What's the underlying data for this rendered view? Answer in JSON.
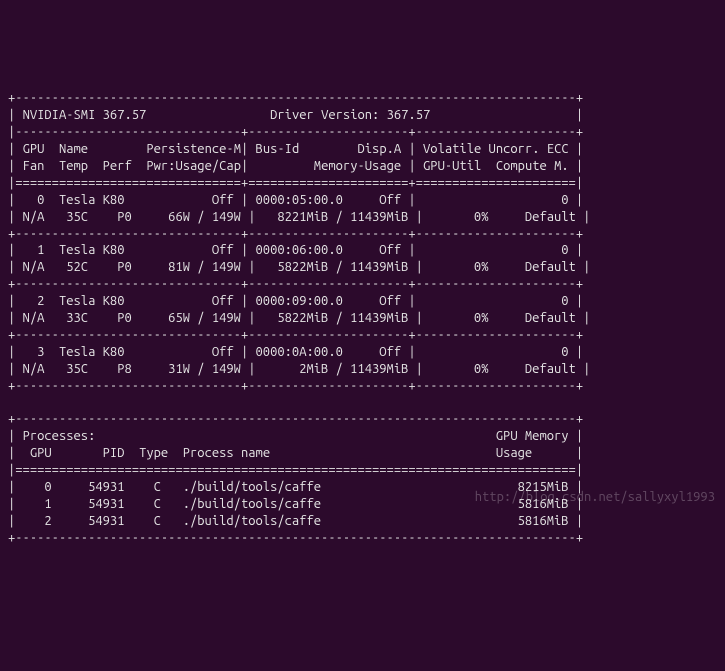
{
  "header": {
    "smi_label": "NVIDIA-SMI",
    "smi_version": "367.57",
    "driver_label": "Driver Version:",
    "driver_version": "367.57"
  },
  "col_headers": {
    "gpu": "GPU",
    "name": "Name",
    "persistence": "Persistence-M",
    "bus": "Bus-Id",
    "disp": "Disp.A",
    "volatile": "Volatile",
    "uncorr": "Uncorr. ECC",
    "fan": "Fan",
    "temp": "Temp",
    "perf": "Perf",
    "pwr": "Pwr:Usage/Cap",
    "memusage": "Memory-Usage",
    "gpuutil": "GPU-Util",
    "compute": "Compute M."
  },
  "gpus": [
    {
      "id": "0",
      "name": "Tesla K80",
      "persist": "Off",
      "bus": "0000:05:00.0",
      "disp": "Off",
      "ecc": "0",
      "fan": "N/A",
      "temp": "35C",
      "perf": "P0",
      "pwr_use": "66W",
      "pwr_cap": "149W",
      "mem_use": "8221MiB",
      "mem_tot": "11439MiB",
      "util": "0%",
      "compute": "Default"
    },
    {
      "id": "1",
      "name": "Tesla K80",
      "persist": "Off",
      "bus": "0000:06:00.0",
      "disp": "Off",
      "ecc": "0",
      "fan": "N/A",
      "temp": "52C",
      "perf": "P0",
      "pwr_use": "81W",
      "pwr_cap": "149W",
      "mem_use": "5822MiB",
      "mem_tot": "11439MiB",
      "util": "0%",
      "compute": "Default"
    },
    {
      "id": "2",
      "name": "Tesla K80",
      "persist": "Off",
      "bus": "0000:09:00.0",
      "disp": "Off",
      "ecc": "0",
      "fan": "N/A",
      "temp": "33C",
      "perf": "P0",
      "pwr_use": "65W",
      "pwr_cap": "149W",
      "mem_use": "5822MiB",
      "mem_tot": "11439MiB",
      "util": "0%",
      "compute": "Default"
    },
    {
      "id": "3",
      "name": "Tesla K80",
      "persist": "Off",
      "bus": "0000:0A:00.0",
      "disp": "Off",
      "ecc": "0",
      "fan": "N/A",
      "temp": "35C",
      "perf": "P8",
      "pwr_use": "31W",
      "pwr_cap": "149W",
      "mem_use": "2MiB",
      "mem_tot": "11439MiB",
      "util": "0%",
      "compute": "Default"
    }
  ],
  "proc": {
    "title": "Processes:",
    "mem_title": "GPU Memory",
    "h_gpu": "GPU",
    "h_pid": "PID",
    "h_type": "Type",
    "h_name": "Process name",
    "h_usage": "Usage",
    "rows": [
      {
        "gpu": "0",
        "pid": "54931",
        "type": "C",
        "name": "./build/tools/caffe",
        "mem": "8215MiB"
      },
      {
        "gpu": "1",
        "pid": "54931",
        "type": "C",
        "name": "./build/tools/caffe",
        "mem": "5816MiB"
      },
      {
        "gpu": "2",
        "pid": "54931",
        "type": "C",
        "name": "./build/tools/caffe",
        "mem": "5816MiB"
      }
    ]
  },
  "watermark": "http://blog.csdn.net/sallyxyl1993"
}
